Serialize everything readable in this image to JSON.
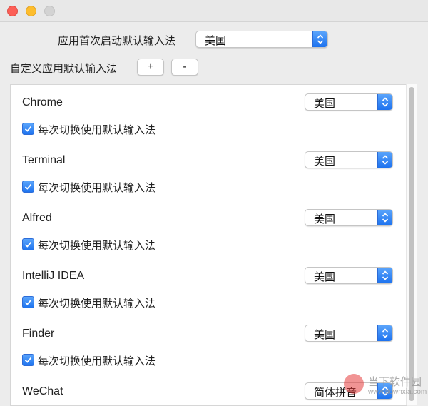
{
  "window": {
    "traffic_lights": [
      "close",
      "minimize",
      "zoom"
    ]
  },
  "default_input": {
    "label": "应用首次启动默认输入法",
    "value": "美国"
  },
  "custom_apps": {
    "label": "自定义应用默认输入法",
    "add_label": "+",
    "remove_label": "-"
  },
  "apps": [
    {
      "name": "Chrome",
      "input": "美国",
      "checkbox_label": "每次切换使用默认输入法",
      "checked": true
    },
    {
      "name": "Terminal",
      "input": "美国",
      "checkbox_label": "每次切换使用默认输入法",
      "checked": true
    },
    {
      "name": "Alfred",
      "input": "美国",
      "checkbox_label": "每次切换使用默认输入法",
      "checked": true
    },
    {
      "name": "IntelliJ IDEA",
      "input": "美国",
      "checkbox_label": "每次切换使用默认输入法",
      "checked": true
    },
    {
      "name": "Finder",
      "input": "美国",
      "checkbox_label": "每次切换使用默认输入法",
      "checked": true
    },
    {
      "name": "WeChat",
      "input": "简体拼音"
    }
  ],
  "watermark": {
    "name": "当下软件园",
    "url": "www.downxia.com"
  },
  "colors": {
    "accent": "#1f74ef",
    "close": "#fc5f57",
    "minimize": "#fdbd2e"
  }
}
